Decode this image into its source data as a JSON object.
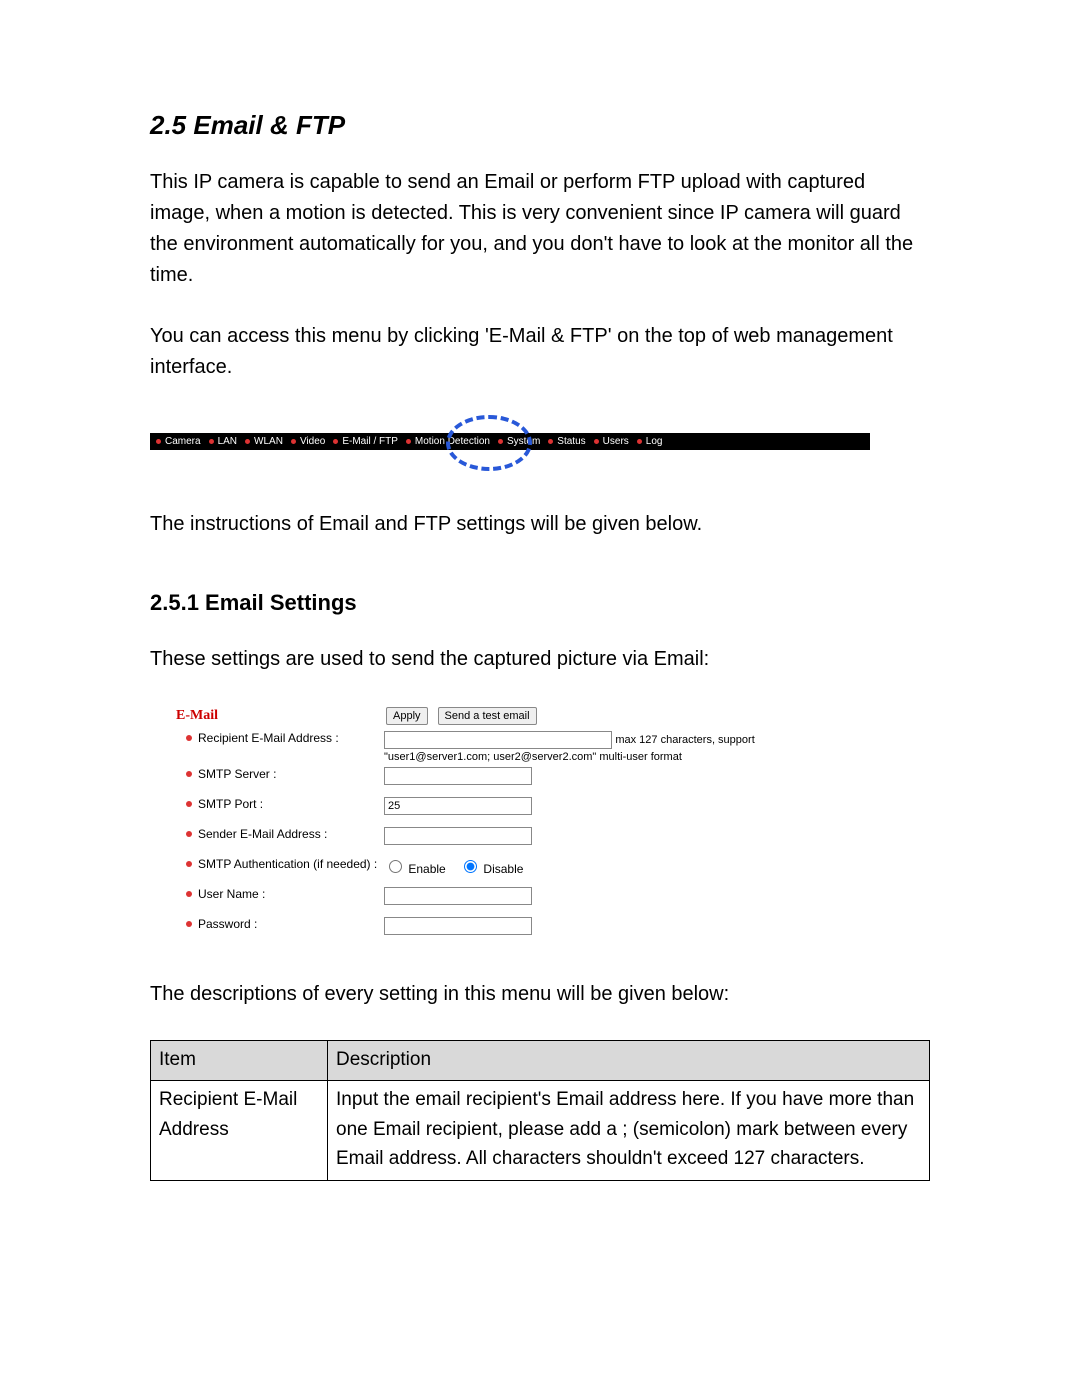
{
  "section": {
    "title": "2.5 Email & FTP",
    "para1": "This IP camera is capable to send an Email or perform FTP upload with captured image, when a motion is detected. This is very convenient since IP camera will guard the environment automatically for you, and you don't have to look at the monitor all the time.",
    "para2": "You can access this menu by clicking 'E-Mail & FTP' on the top of web management interface.",
    "instr_line": "The instructions of Email and FTP settings will be given below."
  },
  "navbar_items": [
    "Camera",
    "LAN",
    "WLAN",
    "Video",
    "E-Mail / FTP",
    "Motion Detection",
    "System",
    "Status",
    "Users",
    "Log"
  ],
  "subsection": {
    "title": "2.5.1 Email Settings",
    "intro": "These settings are used to send the captured picture via Email:"
  },
  "email_form": {
    "panel_title": "E-Mail",
    "btn_apply": "Apply",
    "btn_test": "Send a test email",
    "fields": {
      "recipient_label": "Recipient E-Mail Address :",
      "recipient_value": "",
      "recipient_hint1": "max 127 characters, support",
      "recipient_hint2": "\"user1@server1.com; user2@server2.com\" multi-user format",
      "smtp_server_label": "SMTP Server :",
      "smtp_server_value": "",
      "smtp_port_label": "SMTP Port :",
      "smtp_port_value": "25",
      "sender_label": "Sender E-Mail Address :",
      "sender_value": "",
      "auth_label": "SMTP Authentication (if needed) :",
      "auth_enable": "Enable",
      "auth_disable": "Disable",
      "user_label": "User Name :",
      "user_value": "",
      "pass_label": "Password :",
      "pass_value": ""
    }
  },
  "table_intro": "The descriptions of every setting in this menu will be given below:",
  "desc_table": {
    "header_item": "Item",
    "header_desc": "Description",
    "row1_item": "Recipient E-Mail Address",
    "row1_desc": "Input the email recipient's Email address here. If you have more than one Email recipient, please add a ; (semicolon) mark between every Email address. All characters shouldn't exceed 127 characters."
  }
}
